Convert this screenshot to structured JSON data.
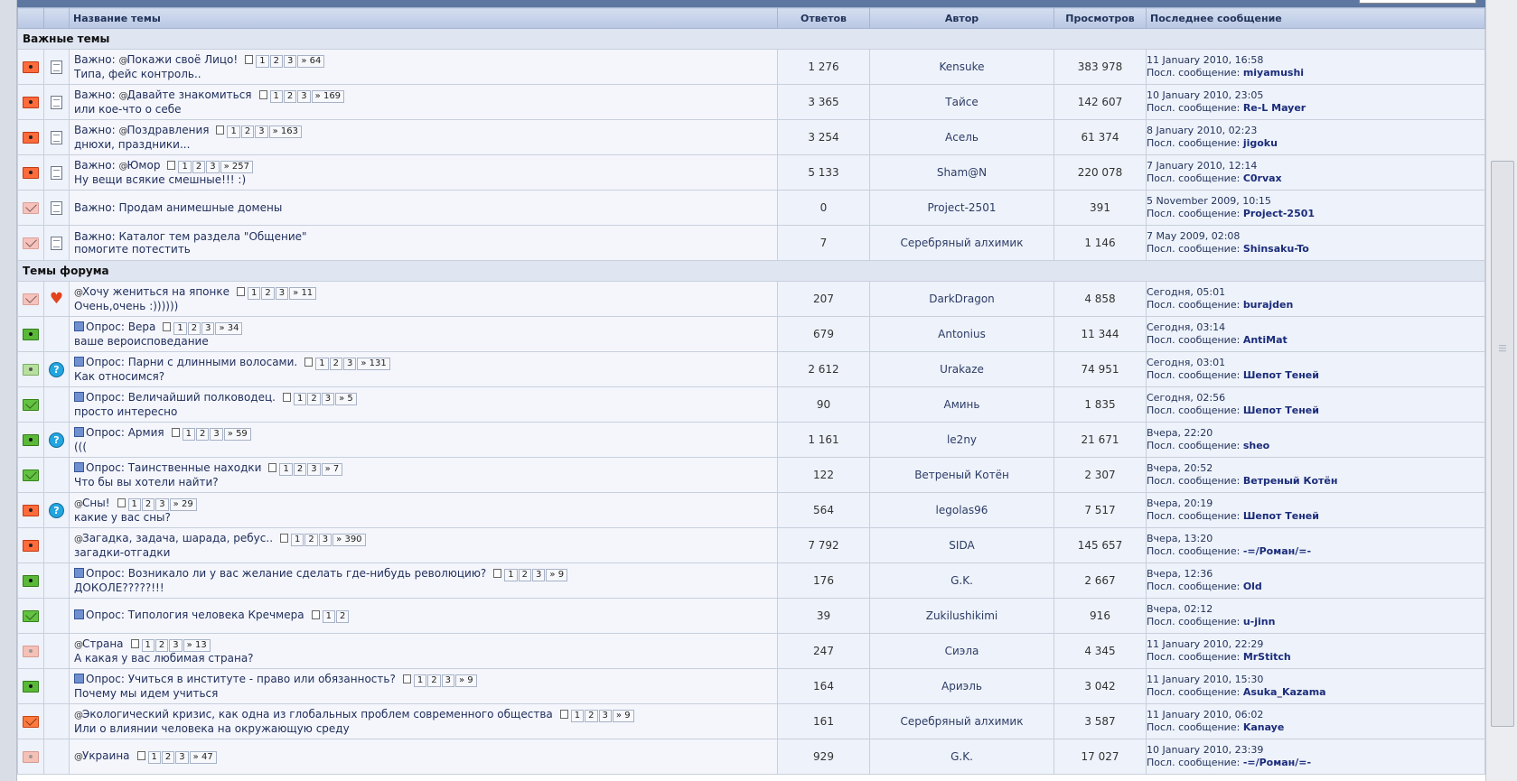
{
  "header": {
    "title": "Название темы",
    "replies": "Ответов",
    "author": "Автор",
    "views": "Просмотров",
    "last": "Последнее сообщение"
  },
  "colors": {
    "header_band": "#5d77a1",
    "row_bg": "#eef2fa",
    "section_bg": "#dfe5f1",
    "link": "#1a2c7a"
  },
  "labels": {
    "last_by": "Посл. сообщение:",
    "page_more": "»"
  },
  "sections": [
    {
      "title": "Важные темы",
      "rows": [
        {
          "icon": "hot-poll-icon",
          "icon2": "doc-icon",
          "prefix": "Важно:",
          "title": "Покажи своё Лицо!",
          "desc": "Типа, фейс контроль..",
          "pages": [
            "1",
            "2",
            "3"
          ],
          "last_page": "64",
          "replies": "1 276",
          "author": "Kensuke",
          "views": "383 978",
          "last_date": "11 January 2010, 16:58",
          "last_by": "miyamushi"
        },
        {
          "icon": "hot-poll-icon",
          "icon2": "doc-icon",
          "prefix": "Важно:",
          "title": "Давайте знакомиться",
          "desc": "или кое-что о себе",
          "pages": [
            "1",
            "2",
            "3"
          ],
          "last_page": "169",
          "replies": "3 365",
          "author": "Тайсе",
          "views": "142 607",
          "last_date": "10 January 2010, 23:05",
          "last_by": "Re-L Mayer"
        },
        {
          "icon": "hot-poll-icon",
          "icon2": "doc-icon",
          "prefix": "Важно:",
          "title": "Поздравления",
          "desc": "днюхи, праздники...",
          "pages": [
            "1",
            "2",
            "3"
          ],
          "last_page": "163",
          "replies": "3 254",
          "author": "Асель",
          "views": "61 374",
          "last_date": "8 January 2010, 02:23",
          "last_by": "jigoku"
        },
        {
          "icon": "hot-poll-icon",
          "icon2": "doc-icon",
          "prefix": "Важно:",
          "title": "Юмор",
          "desc": "Ну вещи всякие смешные!!! :)",
          "pages": [
            "1",
            "2",
            "3"
          ],
          "last_page": "257",
          "replies": "5 133",
          "author": "Sham@N",
          "views": "220 078",
          "last_date": "7 January 2010, 12:14",
          "last_by": "C0rvax"
        },
        {
          "icon": "pale-mail-icon",
          "icon2": "doc-icon",
          "prefix": "Важно:",
          "title": "Продам анимешные домены",
          "desc": "",
          "pages": [],
          "last_page": "",
          "replies": "0",
          "author": "Project-2501",
          "views": "391",
          "last_date": "5 November 2009, 10:15",
          "last_by": "Project-2501"
        },
        {
          "icon": "pale-mail-icon",
          "icon2": "doc-icon",
          "prefix": "Важно:",
          "title": "Каталог тем раздела \"Общение\"",
          "desc": "помогите потестить",
          "pages": [],
          "last_page": "",
          "replies": "7",
          "author": "Серебряный алхимик",
          "views": "1 146",
          "last_date": "7 May 2009, 02:08",
          "last_by": "Shinsaku-To"
        }
      ]
    },
    {
      "title": "Темы форума",
      "rows": [
        {
          "icon": "pale-mail-icon",
          "icon2": "heart-icon",
          "prefix": "",
          "title": "Хочу жениться на японке",
          "desc": "Очень,очень :))))))",
          "pages": [
            "1",
            "2",
            "3"
          ],
          "last_page": "11",
          "replies": "207",
          "author": "DarkDragon",
          "views": "4 858",
          "last_date": "Сегодня, 05:01",
          "last_by": "burajden"
        },
        {
          "icon": "green-poll-icon",
          "icon2": "",
          "prefix": "Опрос:",
          "title": "Вера",
          "desc": "ваше вероисповедание",
          "pages": [
            "1",
            "2",
            "3"
          ],
          "last_page": "34",
          "replies": "679",
          "author": "Antonius",
          "views": "11 344",
          "last_date": "Сегодня, 03:14",
          "last_by": "AntiMat"
        },
        {
          "icon": "lgreen-poll-icon",
          "icon2": "question-icon",
          "prefix": "Опрос:",
          "title": "Парни с длинными волосами.",
          "desc": "Как относимся?",
          "pages": [
            "1",
            "2",
            "3"
          ],
          "last_page": "131",
          "replies": "2 612",
          "author": "Urakaze",
          "views": "74 951",
          "last_date": "Сегодня, 03:01",
          "last_by": "Шепот Теней"
        },
        {
          "icon": "green-mail-icon",
          "icon2": "",
          "prefix": "Опрос:",
          "title": "Величайший полководец.",
          "desc": "просто интересно",
          "pages": [
            "1",
            "2",
            "3"
          ],
          "last_page": "5",
          "replies": "90",
          "author": "Аминь",
          "views": "1 835",
          "last_date": "Сегодня, 02:56",
          "last_by": "Шепот Теней"
        },
        {
          "icon": "green-poll-icon",
          "icon2": "question-icon",
          "prefix": "Опрос:",
          "title": "Армия",
          "desc": "(((",
          "pages": [
            "1",
            "2",
            "3"
          ],
          "last_page": "59",
          "replies": "1 161",
          "author": "le2ny",
          "views": "21 671",
          "last_date": "Вчера, 22:20",
          "last_by": "sheo"
        },
        {
          "icon": "green-mail-icon",
          "icon2": "",
          "prefix": "Опрос:",
          "title": "Таинственные находки",
          "desc": "Что бы вы хотели найти?",
          "pages": [
            "1",
            "2",
            "3"
          ],
          "last_page": "7",
          "replies": "122",
          "author": "Ветреный Котён",
          "views": "2 307",
          "last_date": "Вчера, 20:52",
          "last_by": "Ветреный Котён"
        },
        {
          "icon": "hot-poll-icon",
          "icon2": "question-icon",
          "prefix": "",
          "title": "Сны!",
          "desc": "какие у вас сны?",
          "pages": [
            "1",
            "2",
            "3"
          ],
          "last_page": "29",
          "replies": "564",
          "author": "legolas96",
          "views": "7 517",
          "last_date": "Вчера, 20:19",
          "last_by": "Шепот Теней"
        },
        {
          "icon": "hot-poll-icon",
          "icon2": "",
          "prefix": "",
          "title": "Загадка, задача, шарада, ребус..",
          "desc": "загадки-отгадки",
          "pages": [
            "1",
            "2",
            "3"
          ],
          "last_page": "390",
          "replies": "7 792",
          "author": "SIDA",
          "views": "145 657",
          "last_date": "Вчера, 13:20",
          "last_by": "-=/Роман/=-"
        },
        {
          "icon": "green-poll-icon",
          "icon2": "",
          "prefix": "Опрос:",
          "title": "Возникало ли у вас желание сделать где-нибудь революцию?",
          "desc": "ДОКОЛЕ?????!!!",
          "pages": [
            "1",
            "2",
            "3"
          ],
          "last_page": "9",
          "replies": "176",
          "author": "G.K.",
          "views": "2 667",
          "last_date": "Вчера, 12:36",
          "last_by": "Old"
        },
        {
          "icon": "green-mail-icon",
          "icon2": "",
          "prefix": "Опрос:",
          "title": "Типология человека Кречмера",
          "desc": "",
          "pages": [
            "1",
            "2"
          ],
          "last_page": "",
          "replies": "39",
          "author": "Zukilushikimi",
          "views": "916",
          "last_date": "Вчера, 02:12",
          "last_by": "u-jinn"
        },
        {
          "icon": "pale-poll-icon",
          "icon2": "",
          "prefix": "",
          "title": "Страна",
          "desc": "А какая у вас любимая страна?",
          "pages": [
            "1",
            "2",
            "3"
          ],
          "last_page": "13",
          "replies": "247",
          "author": "Сиэла",
          "views": "4 345",
          "last_date": "11 January 2010, 22:29",
          "last_by": "MrStitch"
        },
        {
          "icon": "green-poll-icon",
          "icon2": "",
          "prefix": "Опрос:",
          "title": "Учиться в институте - право или обязанность?",
          "desc": "Почему мы идем учиться",
          "pages": [
            "1",
            "2",
            "3"
          ],
          "last_page": "9",
          "replies": "164",
          "author": "Ариэль",
          "views": "3 042",
          "last_date": "11 January 2010, 15:30",
          "last_by": "Asuka_Kazama"
        },
        {
          "icon": "orange-mail-icon",
          "icon2": "",
          "prefix": "",
          "title": "Экологический кризис, как одна из глобальных проблем современного общества",
          "desc": "Или о влиянии человека на окружающую среду",
          "pages": [
            "1",
            "2",
            "3"
          ],
          "last_page": "9",
          "replies": "161",
          "author": "Серебряный алхимик",
          "views": "3 587",
          "last_date": "11 January 2010, 06:02",
          "last_by": "Kanaye"
        },
        {
          "icon": "pale-poll-icon",
          "icon2": "",
          "prefix": "",
          "title": "Украина",
          "desc": "",
          "pages": [
            "1",
            "2",
            "3"
          ],
          "last_page": "47",
          "replies": "929",
          "author": "G.K.",
          "views": "17 027",
          "last_date": "10 January 2010, 23:39",
          "last_by": "-=/Роман/=-"
        }
      ]
    }
  ]
}
